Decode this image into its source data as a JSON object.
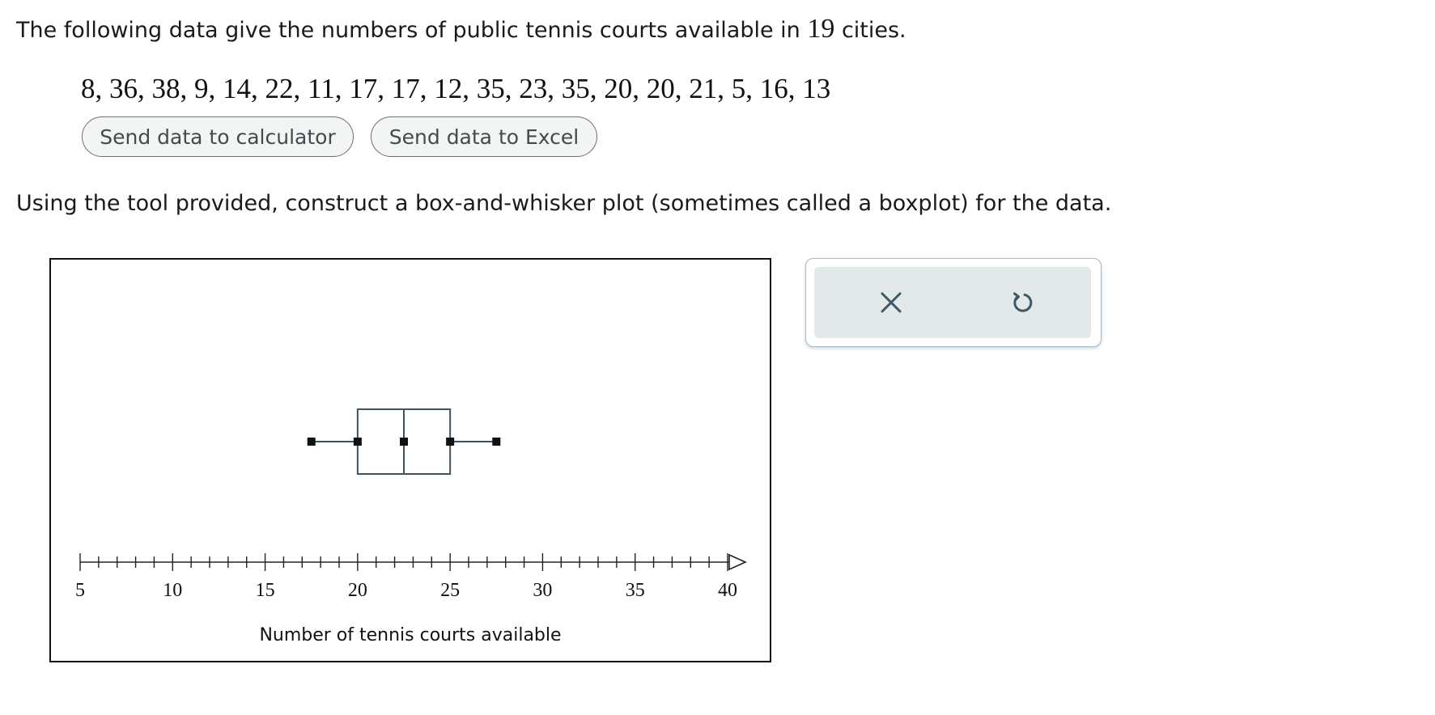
{
  "intro": {
    "before": "The following data give the numbers of public tennis courts available in ",
    "count": "19",
    "after": " cities."
  },
  "data_values_text": "8, 36, 38, 9, 14, 22, 11, 17, 17, 12, 35, 23, 35, 20, 20, 21, 5, 16, 13",
  "buttons": {
    "calculator": "Send data to calculator",
    "excel": "Send data to Excel"
  },
  "instruction": "Using the tool provided, construct a box-and-whisker plot (sometimes called a boxplot) for the data.",
  "tool": {
    "clear_icon": "close-icon",
    "reset_icon": "undo-icon"
  },
  "chart_data": {
    "type": "boxplot",
    "xlabel": "Number of tennis courts available",
    "xlim": [
      5,
      40
    ],
    "major_ticks": [
      5,
      10,
      15,
      20,
      25,
      30,
      35,
      40
    ],
    "minor_tick_step": 1,
    "tick_labels": [
      "5",
      "10",
      "15",
      "20",
      "25",
      "30",
      "35",
      "40"
    ],
    "box": {
      "min": 17.5,
      "q1": 20,
      "median": 22.5,
      "q3": 25,
      "max": 27.5
    },
    "colors": {
      "box_stroke": "#3d5560",
      "handle": "#111111",
      "axis": "#222222"
    }
  }
}
